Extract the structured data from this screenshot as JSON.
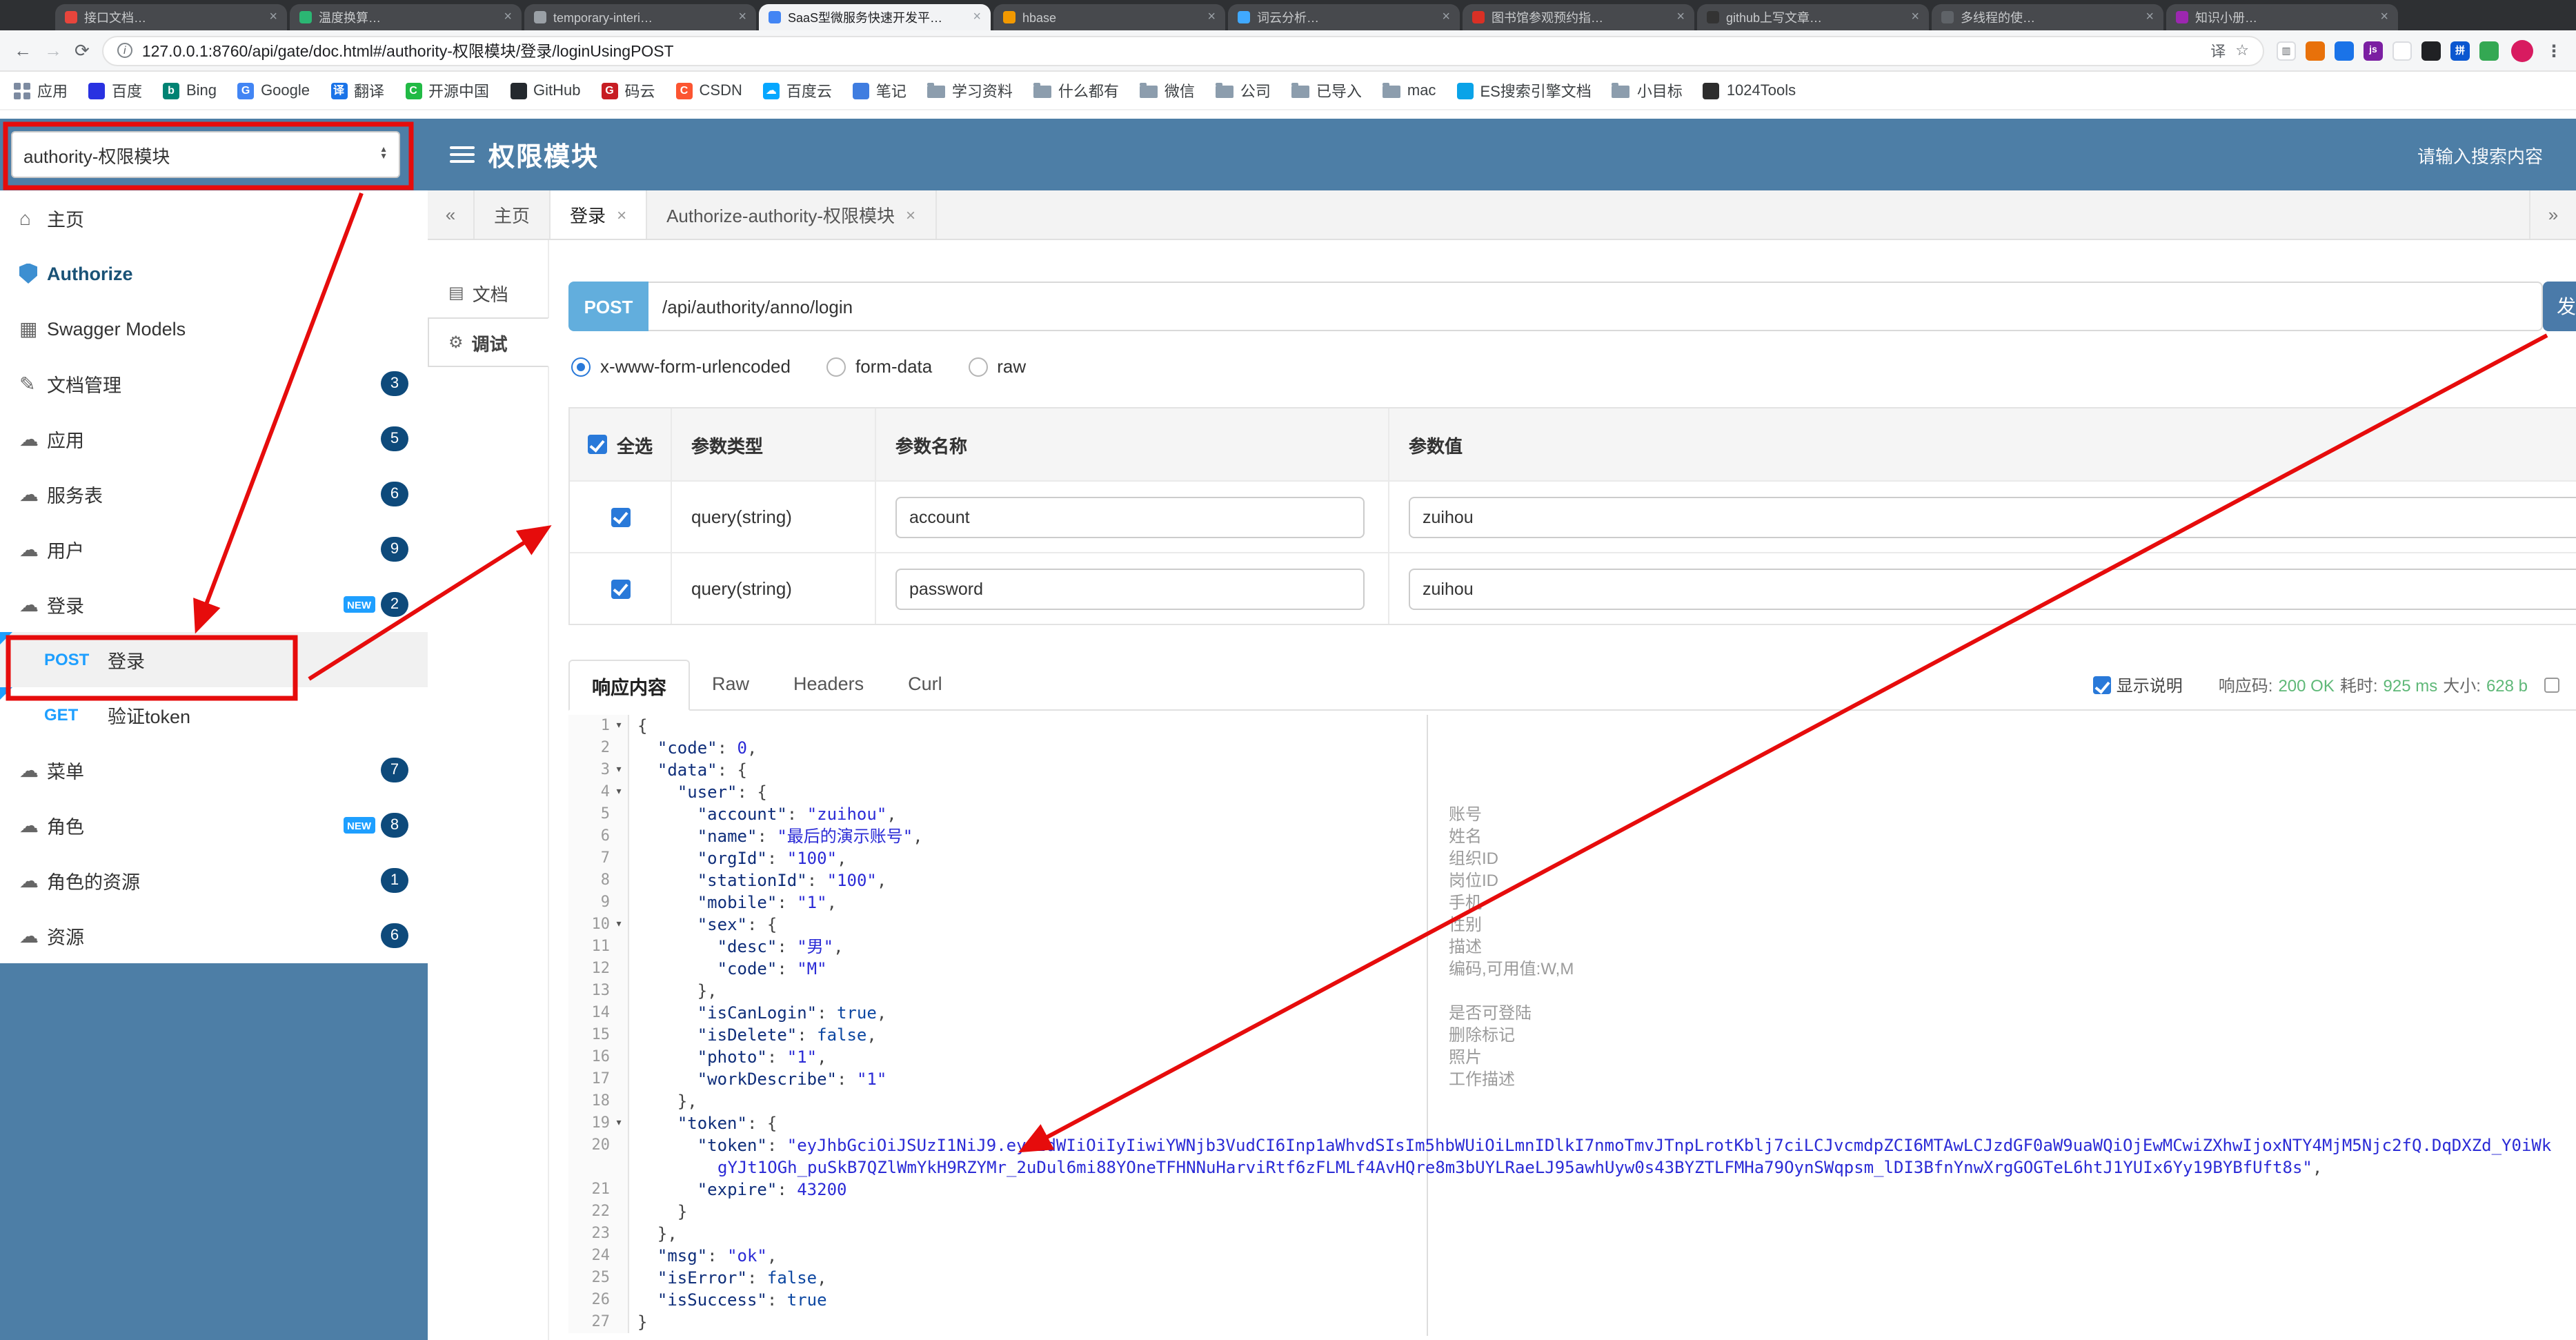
{
  "browser": {
    "tabs": [
      {
        "label": "接口文档…",
        "color": "#e8453c"
      },
      {
        "label": "温度换算…",
        "color": "#2bb673"
      },
      {
        "label": "temporary-interi…",
        "color": "#9aa0a6"
      },
      {
        "label": "SaaS型微服务快速开发平…",
        "color": "#4285f4",
        "active": true
      },
      {
        "label": "hbase",
        "color": "#f29900"
      },
      {
        "label": "词云分析…",
        "color": "#40a9ff"
      },
      {
        "label": "图书馆参观预约指…",
        "color": "#d93025"
      },
      {
        "label": "github上写文章…",
        "color": "#333333"
      },
      {
        "label": "多线程的使…",
        "color": "#5f6368"
      },
      {
        "label": "知识小册…",
        "color": "#9c27b0"
      }
    ],
    "url": "127.0.0.1:8760/api/gate/doc.html#/authority-权限模块/登录/loginUsingPOST",
    "menu_icon": "⋮",
    "toolbar_icons": [
      {
        "name": "side-panel-icon",
        "color": "#ffffff",
        "glyph": "▥",
        "fg": "#5f6368",
        "border": true
      },
      {
        "name": "extension-icon-1",
        "color": "#e8710a",
        "glyph": ""
      },
      {
        "name": "extension-icon-2",
        "color": "#1a73e8",
        "glyph": ""
      },
      {
        "name": "extension-icon-3",
        "color": "#7b1fa2",
        "glyph": "js"
      },
      {
        "name": "extension-icon-4",
        "color": "#ffffff",
        "glyph": "",
        "border": true
      },
      {
        "name": "extension-icon-5",
        "color": "#202124",
        "glyph": ""
      },
      {
        "name": "extension-icon-6",
        "color": "#0b57d0",
        "glyph": "拼"
      },
      {
        "name": "extension-icon-7",
        "color": "#34a853",
        "glyph": ""
      }
    ],
    "bookmarks": [
      {
        "label": "应用",
        "icon": "apps-grid-icon",
        "type": "grid"
      },
      {
        "label": "百度",
        "icon": "baidu-icon",
        "color": "#2932e1"
      },
      {
        "label": "Bing",
        "icon": "bing-icon",
        "color": "#008373",
        "glyph": "b"
      },
      {
        "label": "Google",
        "icon": "google-icon",
        "color": "#4285f4",
        "glyph": "G"
      },
      {
        "label": "翻译",
        "icon": "translate-icon",
        "color": "#1a73e8",
        "glyph": "译"
      },
      {
        "label": "开源中国",
        "icon": "oschina-icon",
        "color": "#21ba45",
        "glyph": "C"
      },
      {
        "label": "GitHub",
        "icon": "github-icon",
        "color": "#24292e"
      },
      {
        "label": "码云",
        "icon": "gitee-icon",
        "color": "#c71d23",
        "glyph": "G"
      },
      {
        "label": "CSDN",
        "icon": "csdn-icon",
        "color": "#fc5531",
        "glyph": "C"
      },
      {
        "label": "百度云",
        "icon": "baidu-cloud-icon",
        "color": "#06a7ff",
        "glyph": "☁"
      },
      {
        "label": "笔记",
        "icon": "note-icon",
        "color": "#3f7de0"
      },
      {
        "label": "学习资料",
        "icon": "folder-icon",
        "type": "folder"
      },
      {
        "label": "什么都有",
        "icon": "folder-icon",
        "type": "folder"
      },
      {
        "label": "微信",
        "icon": "folder-icon",
        "type": "folder"
      },
      {
        "label": "公司",
        "icon": "folder-icon",
        "type": "folder"
      },
      {
        "label": "已导入",
        "icon": "folder-icon",
        "type": "folder"
      },
      {
        "label": "mac",
        "icon": "folder-icon",
        "type": "folder"
      },
      {
        "label": "ES搜索引擎文档",
        "icon": "es-doc-icon",
        "color": "#0aa3e8"
      },
      {
        "label": "小目标",
        "icon": "folder-icon",
        "type": "folder"
      },
      {
        "label": "1024Tools",
        "icon": "tools-icon",
        "color": "#2d2d2d"
      }
    ]
  },
  "header": {
    "group_select_value": "authority-权限模块",
    "title": "权限模块",
    "search_placeholder": "请输入搜索内容"
  },
  "sidebar": {
    "items": [
      {
        "label": "主页",
        "icon": "home-icon",
        "glyph": "⌂"
      },
      {
        "label": "Authorize",
        "icon": "authorize-shield-icon",
        "authorize": true
      },
      {
        "label": "Swagger Models",
        "icon": "models-icon",
        "glyph": "▦"
      },
      {
        "label": "文档管理",
        "icon": "doc-manage-icon",
        "glyph": "✎",
        "badge": "3"
      },
      {
        "label": "应用",
        "icon": "cloud-icon",
        "glyph": "☁",
        "badge": "5"
      },
      {
        "label": "服务表",
        "icon": "cloud-icon",
        "glyph": "☁",
        "badge": "6"
      },
      {
        "label": "用户",
        "icon": "cloud-icon",
        "glyph": "☁",
        "badge": "9"
      },
      {
        "label": "登录",
        "icon": "cloud-icon",
        "glyph": "☁",
        "badge": "2",
        "isNew": true
      },
      {
        "method": "POST",
        "label": "登录",
        "child": true,
        "selected": true
      },
      {
        "method": "GET",
        "label": "验证token",
        "child": true
      },
      {
        "label": "菜单",
        "icon": "cloud-icon",
        "glyph": "☁",
        "badge": "7"
      },
      {
        "label": "角色",
        "icon": "cloud-icon",
        "glyph": "☁",
        "badge": "8",
        "isNew": true
      },
      {
        "label": "角色的资源",
        "icon": "cloud-icon",
        "glyph": "☁",
        "badge": "1"
      },
      {
        "label": "资源",
        "icon": "cloud-icon",
        "glyph": "☁",
        "badge": "6"
      }
    ]
  },
  "doc_tabs": {
    "left_arrow": "«",
    "right_arrow": "»",
    "tabs": [
      {
        "label": "主页",
        "closable": false
      },
      {
        "label": "登录",
        "closable": true,
        "active": true
      },
      {
        "label": "Authorize-authority-权限模块",
        "closable": true
      }
    ]
  },
  "side_tabs": [
    {
      "label": "文档",
      "icon": "document-icon",
      "glyph": "▤"
    },
    {
      "label": "调试",
      "icon": "debug-icon",
      "glyph": "⚙",
      "active": true
    }
  ],
  "request": {
    "method": "POST",
    "path": "/api/authority/anno/login",
    "send_label": "发",
    "content_types": [
      {
        "label": "x-www-form-urlencoded",
        "selected": true
      },
      {
        "label": "form-data",
        "selected": false
      },
      {
        "label": "raw",
        "selected": false
      }
    ],
    "params": {
      "select_all_label": "全选",
      "headers": [
        "参数类型",
        "参数名称",
        "参数值"
      ],
      "rows": [
        {
          "checked": true,
          "type": "query(string)",
          "name": "account",
          "value": "zuihou"
        },
        {
          "checked": true,
          "type": "query(string)",
          "name": "password",
          "value": "zuihou"
        }
      ]
    }
  },
  "response": {
    "tabs": [
      {
        "label": "响应内容",
        "active": true
      },
      {
        "label": "Raw"
      },
      {
        "label": "Headers"
      },
      {
        "label": "Curl"
      }
    ],
    "show_desc_label": "显示说明",
    "show_desc_checked": true,
    "meta": {
      "status_label": "响应码:",
      "status": "200 OK",
      "time_label": "耗时:",
      "time": "925 ms",
      "size_label": "大小:",
      "size": "628 b"
    },
    "code_lines": [
      {
        "n": 1,
        "f": true,
        "t": "{"
      },
      {
        "n": 2,
        "t": "  \"code\": 0,"
      },
      {
        "n": 3,
        "f": true,
        "t": "  \"data\": {"
      },
      {
        "n": 4,
        "f": true,
        "t": "    \"user\": {"
      },
      {
        "n": 5,
        "t": "      \"account\": \"zuihou\",",
        "a": "账号"
      },
      {
        "n": 6,
        "t": "      \"name\": \"最后的演示账号\",",
        "a": "姓名"
      },
      {
        "n": 7,
        "t": "      \"orgId\": \"100\",",
        "a": "组织ID"
      },
      {
        "n": 8,
        "t": "      \"stationId\": \"100\",",
        "a": "岗位ID"
      },
      {
        "n": 9,
        "t": "      \"mobile\": \"1\",",
        "a": "手机"
      },
      {
        "n": 10,
        "f": true,
        "t": "      \"sex\": {",
        "a": "性别"
      },
      {
        "n": 11,
        "t": "        \"desc\": \"男\",",
        "a": "描述"
      },
      {
        "n": 12,
        "t": "        \"code\": \"M\"",
        "a": "编码,可用值:W,M"
      },
      {
        "n": 13,
        "t": "      },"
      },
      {
        "n": 14,
        "t": "      \"isCanLogin\": true,",
        "a": "是否可登陆"
      },
      {
        "n": 15,
        "t": "      \"isDelete\": false,",
        "a": "删除标记"
      },
      {
        "n": 16,
        "t": "      \"photo\": \"1\",",
        "a": "照片"
      },
      {
        "n": 17,
        "t": "      \"workDescribe\": \"1\"",
        "a": "工作描述"
      },
      {
        "n": 18,
        "t": "    },"
      },
      {
        "n": 19,
        "f": true,
        "t": "    \"token\": {"
      },
      {
        "n": 20,
        "t": "      \"token\": \"eyJhbGciOiJSUzI1NiJ9.eyJzdWIiOiIyIiwiYWNjb3VudCI6Inp1aWhvdSIsIm5hbWUiOiLmnIDlkI7nmoTmvJTnpLrotKblj7ciLCJvcmdpZCI6MTAwLCJzdGF0aW9uaWQiOjEwMCwiZXhwIjoxNTY4MjM5Njc2fQ.DqDXZd_Y0iWkgYJt1OGh_puSkB7QZlWmYkH9RZYMr_2uDul6mi88YOneTFHNNuHarviRtf6zFLMLf4AvHQre8m3bUYLRaeLJ95awhUyw0s43BYZTLFMHa79OynSWqpsm_lDI3BfnYnwXrgGOGTeL6htJ1YUIx6Yy19BYBfUft8s\","
      },
      {
        "n": 21,
        "t": "      \"expire\": 43200"
      },
      {
        "n": 22,
        "t": "    }"
      },
      {
        "n": 23,
        "t": "  },"
      },
      {
        "n": 24,
        "t": "  \"msg\": \"ok\","
      },
      {
        "n": 25,
        "t": "  \"isError\": false,"
      },
      {
        "n": 26,
        "t": "  \"isSuccess\": true"
      },
      {
        "n": 27,
        "t": "}"
      }
    ]
  },
  "annotation_overlay": {
    "color": "#e60c0c"
  }
}
